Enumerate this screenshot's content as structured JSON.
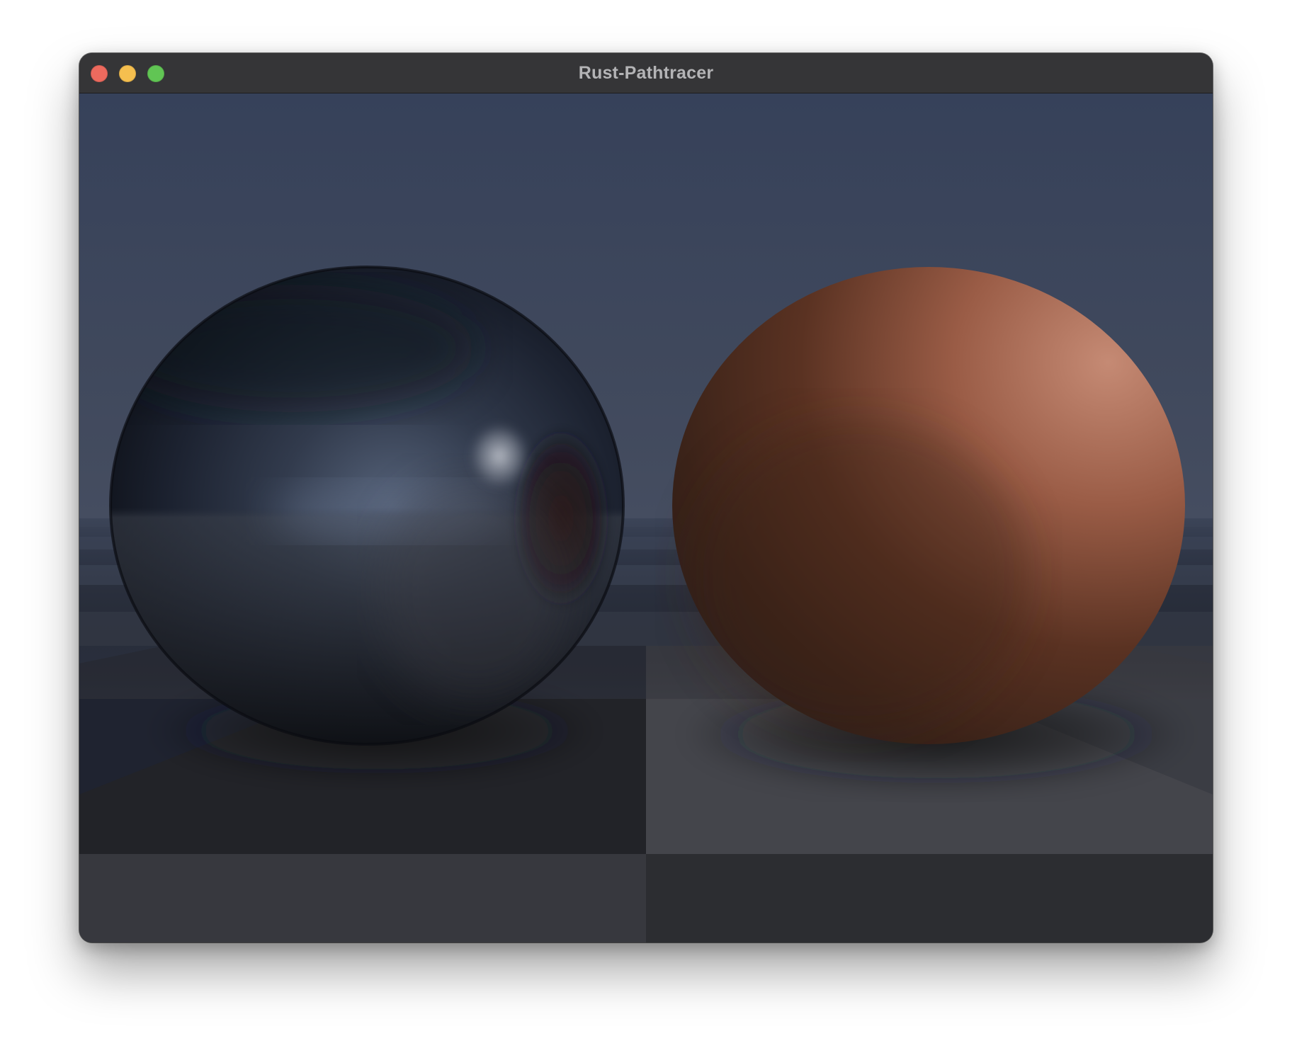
{
  "window": {
    "title": "Rust-Pathtracer",
    "controls": {
      "close": "close-button",
      "minimize": "minimize-button",
      "zoom": "zoom-button"
    },
    "colors": {
      "close": "#ed6a5e",
      "minimize": "#f5bf4f",
      "zoom": "#61c554",
      "titlebar": "#353537",
      "title_text": "#b4b4b6"
    }
  },
  "scene": {
    "description_colors": {
      "sky_top": "#38435a",
      "sky_horizon": "#414a5e",
      "metal_sphere": "#1b2230",
      "diffuse_sphere": "#a4604a",
      "floor_dark": "#23252c",
      "floor_light": "#3e3f45"
    }
  }
}
